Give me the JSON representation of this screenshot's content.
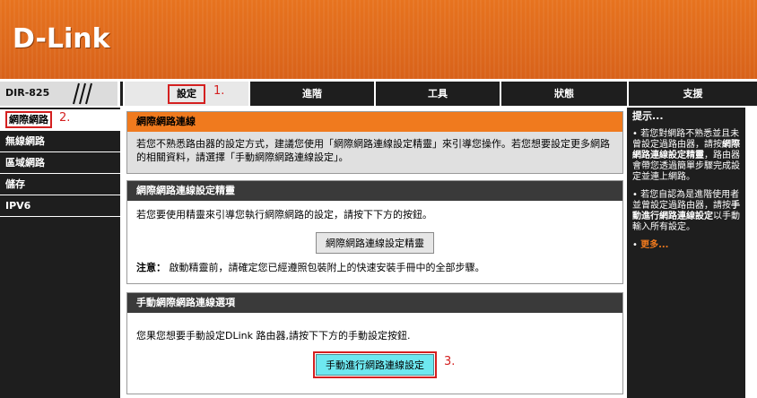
{
  "header": {
    "logo": "D-Link",
    "model": "DIR-825"
  },
  "nav": {
    "tabs": [
      {
        "label": "設定",
        "active": true
      },
      {
        "label": "進階",
        "active": false
      },
      {
        "label": "工具",
        "active": false
      },
      {
        "label": "狀態",
        "active": false
      },
      {
        "label": "支援",
        "active": false
      }
    ]
  },
  "annotations": {
    "a1": "1.",
    "a2": "2.",
    "a3": "3."
  },
  "sidebar": {
    "items": [
      {
        "label": "網際網路",
        "active": true
      },
      {
        "label": "無線網路",
        "active": false
      },
      {
        "label": "區域網路",
        "active": false
      },
      {
        "label": "儲存",
        "active": false
      },
      {
        "label": "IPV6",
        "active": false
      }
    ]
  },
  "main": {
    "panel1": {
      "title": "網際網路連線",
      "text": "若您不熟悉路由器的設定方式，建議您使用「網際網路連線設定精靈」來引導您操作。若您想要設定更多網路的相關資料，請選擇「手動網際網路連線設定」。"
    },
    "panel2": {
      "title": "網際網路連線設定精靈",
      "text": "若您要使用精靈來引導您執行網際網路的設定，請按下下方的按鈕。",
      "button": "網際網路連線設定精靈",
      "note_label": "注意：",
      "note": "啟動精靈前，請確定您已經遵照包裝附上的快速安裝手冊中的全部步驟。"
    },
    "panel3": {
      "title": "手動網際網路連線選項",
      "text": "您果您想要手動設定DLink 路由器,請按下下方的手動設定按鈕.",
      "button": "手動進行網路連線設定"
    }
  },
  "help": {
    "title": "提示...",
    "p1_a": "若您對網路不熟悉並且未曾設定過路由器，請按",
    "p1_b": "網際網路連線設定精靈",
    "p1_c": "，路由器會帶您透過簡單步驟完成設定並連上網路。",
    "p2_a": "若您自認為是進階使用者並曾設定過路由器，請按",
    "p2_b": "手動進行網路連線設定",
    "p2_c": "以手動輸入所有設定。",
    "more": "更多..."
  },
  "colors": {
    "accent": "#f07a1e",
    "annotation": "#d42020",
    "dark": "#1e1e1e",
    "button_highlight": "#6ee8f0"
  }
}
